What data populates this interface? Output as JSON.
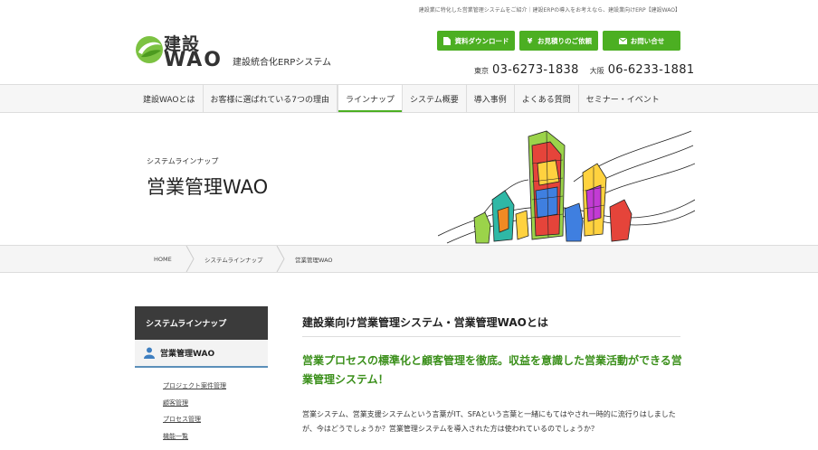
{
  "header": {
    "tagline": "建設業に特化した営業管理システムをご紹介｜建設ERPの導入をお考えなら、建設業向けERP【建設WAO】",
    "logo": {
      "jp": "建設",
      "en": "WAO",
      "subtitle": "建設統合化ERPシステム"
    },
    "buttons": [
      {
        "label": "資料ダウンロード",
        "icon": "document-icon"
      },
      {
        "label": "お見積りのご依頼",
        "icon": "yen-icon"
      },
      {
        "label": "お問い合せ",
        "icon": "mail-icon"
      }
    ],
    "phones": [
      {
        "label": "東京",
        "number": "03-6273-1838"
      },
      {
        "label": "大阪",
        "number": "06-6233-1881"
      }
    ]
  },
  "nav": {
    "items": [
      "建設WAOとは",
      "お客様に選ばれている7つの理由",
      "ラインナップ",
      "システム概要",
      "導入事例",
      "よくある質問",
      "セミナー・イベント"
    ],
    "active_index": 2
  },
  "hero": {
    "eyebrow": "システムラインナップ",
    "title": "営業管理WAO"
  },
  "breadcrumb": [
    "HOME",
    "システムラインナップ",
    "営業管理WAO"
  ],
  "sidebar": {
    "heading": "システムラインナップ",
    "current": "営業管理WAO",
    "links": [
      "プロジェクト案件管理",
      "顧客管理",
      "プロセス管理",
      "機能一覧"
    ]
  },
  "content": {
    "heading": "建設業向け営業管理システム・営業管理WAOとは",
    "lead": "営業プロセスの標準化と顧客管理を徹底。収益を意識した営業活動ができる営業管理システム！",
    "body": "営業システム、営業支援システムという言葉がIT、SFAという言葉と一緒にもてはやされ一時的に流行りはしましたが、今はどうでしょうか？営業管理システムを導入された方は使われているのでしょうか？"
  },
  "colors": {
    "accent_green": "#4caf22",
    "lead_green": "#3a8f1a",
    "sidebar_dark": "#3b3b3b",
    "sidebar_underline": "#5b8fb9"
  }
}
